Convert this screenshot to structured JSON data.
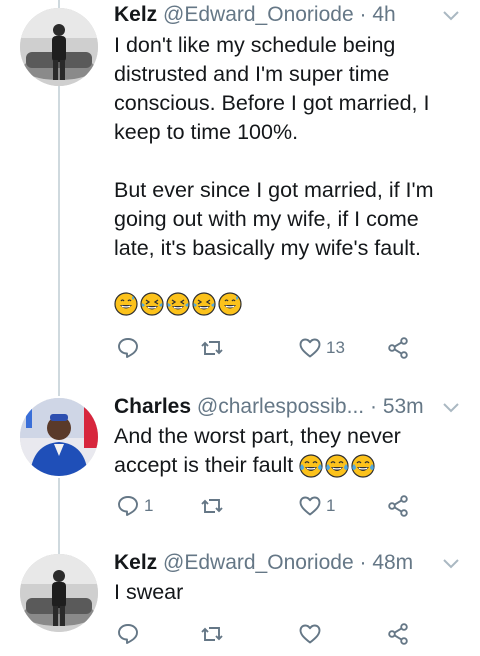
{
  "tweets": [
    {
      "name": "Kelz",
      "handle": "@Edward_Onoriode",
      "dot": "·",
      "time": "4h",
      "paragraphs": [
        "I don't like my schedule being distrusted and I'm super time conscious. Before I got married, I keep to time 100%.",
        "But ever since I got married, if I'm going out with my wife, if I come late, it's basically my wife's fault."
      ],
      "emojis": [
        "grinning-sweat-face",
        "rolling-laughing-face",
        "rolling-laughing-face",
        "rolling-laughing-face",
        "grinning-sweat-face"
      ],
      "replies": "",
      "retweets": "",
      "likes": "13"
    },
    {
      "name": "Charles",
      "handle": "@charlespossib...",
      "dot": "·",
      "time": "53m",
      "text": "And the worst part, they never accept is their fault",
      "emojis": [
        "tears-of-joy-face",
        "tears-of-joy-face",
        "tears-of-joy-face"
      ],
      "replies": "1",
      "retweets": "",
      "likes": "1"
    },
    {
      "name": "Kelz",
      "handle": "@Edward_Onoriode",
      "dot": "·",
      "time": "48m",
      "text": "I swear",
      "replies": "",
      "retweets": "",
      "likes": ""
    }
  ],
  "colors": {
    "text": "#14171a",
    "muted": "#657786",
    "thread": "#cfd9de",
    "emoji_yellow": "#fcc21b"
  }
}
